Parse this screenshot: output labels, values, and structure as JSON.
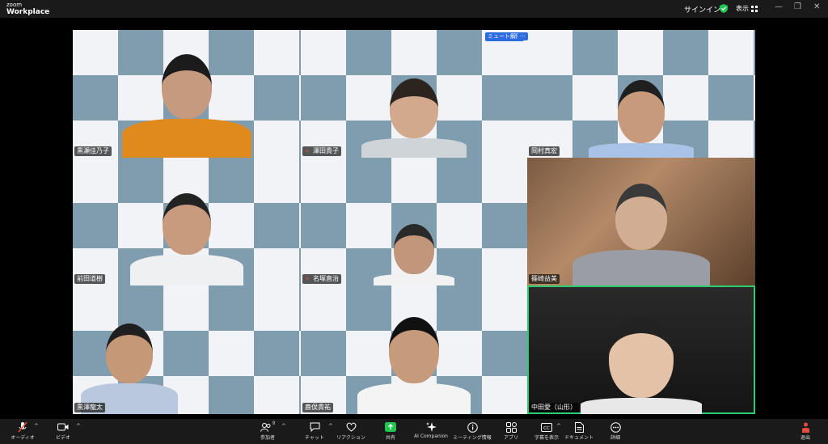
{
  "titlebar": {
    "brand_top": "zoom",
    "brand_bottom": "Workplace",
    "signin": "サインイン",
    "view_label": "表示",
    "minimize": "—",
    "maximize": "❐",
    "close": "✕"
  },
  "gallery": {
    "mute_all": "ミュート解除",
    "more": "···",
    "participants": [
      {
        "name": "黒瀬佳乃子",
        "muted": false
      },
      {
        "name": "澤田貴子",
        "muted": true
      },
      {
        "name": "岡村真宏",
        "muted": false
      },
      {
        "name": "前田道樹",
        "muted": false
      },
      {
        "name": "名塚直治",
        "muted": true
      },
      {
        "name": "篠崎益美",
        "muted": false
      },
      {
        "name": "黒澤龍太",
        "muted": false
      },
      {
        "name": "鹿俣貴祐",
        "muted": false
      },
      {
        "name": "中田愛（山形）",
        "muted": false
      }
    ]
  },
  "toolbar": {
    "audio": "オーディオ",
    "video": "ビデオ",
    "participants": "参加者",
    "participants_count": "9",
    "chat": "チャット",
    "reactions": "リアクション",
    "share": "共有",
    "ai_companion": "AI Companion",
    "meeting_info": "ミーティング情報",
    "apps": "アプリ",
    "captions": "字幕を表示",
    "docs": "ドキュメント",
    "more": "詳細",
    "leave": "退出"
  },
  "colors": {
    "accent": "#2ecc71",
    "muted_red": "#e74c3c",
    "mute_button": "#2d6cdf",
    "share_green": "#23c552"
  }
}
